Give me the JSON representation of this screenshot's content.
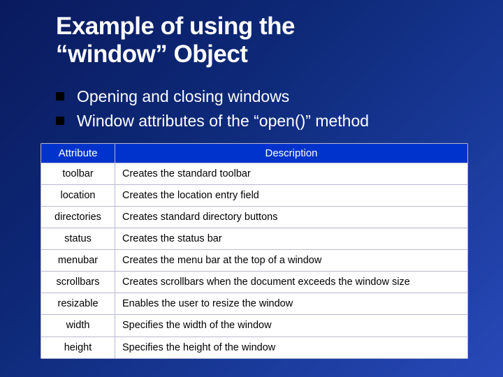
{
  "title_line1": "Example of using the",
  "title_line2": "“window” Object",
  "bullets": [
    "Opening and closing windows",
    "Window attributes of the “open()” method"
  ],
  "table": {
    "head_attr": "Attribute",
    "head_desc": "Description",
    "rows": [
      {
        "attr": "toolbar",
        "desc": "Creates the standard toolbar"
      },
      {
        "attr": "location",
        "desc": "Creates the location entry field"
      },
      {
        "attr": "directories",
        "desc": "Creates standard directory buttons"
      },
      {
        "attr": "status",
        "desc": "Creates the status bar"
      },
      {
        "attr": "menubar",
        "desc": "Creates the menu bar at the top of a window"
      },
      {
        "attr": "scrollbars",
        "desc": "Creates scrollbars when the document exceeds the window size"
      },
      {
        "attr": "resizable",
        "desc": "Enables the user to resize the window"
      },
      {
        "attr": "width",
        "desc": "Specifies the width of the window"
      },
      {
        "attr": "height",
        "desc": "Specifies the height of the window"
      }
    ]
  }
}
